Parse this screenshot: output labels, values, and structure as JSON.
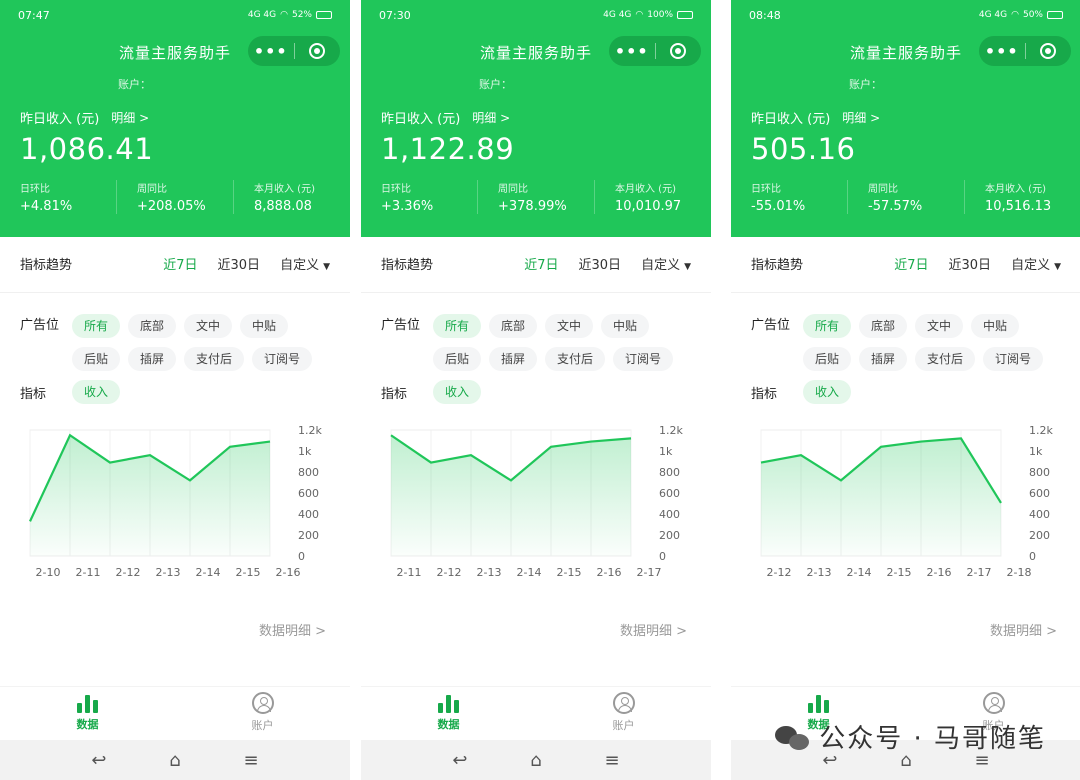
{
  "brand_watermark": "公众号 · 马哥随笔",
  "colors": {
    "primary": "#20c65a",
    "active_text": "#17a94a"
  },
  "screens": [
    {
      "status": {
        "time": "07:47",
        "signal": "4G 4G",
        "battery": "52%"
      },
      "title": "流量主服务助手",
      "account_label": "账户：",
      "income_label": "昨日收入 (元)",
      "detail_label": "明细 >",
      "income": "1,086.41",
      "stats": [
        {
          "label": "日环比",
          "value": "+4.81%"
        },
        {
          "label": "周同比",
          "value": "+208.05%"
        },
        {
          "label": "本月收入 (元)",
          "value": "8,888.08"
        }
      ],
      "trend_label": "指标趋势",
      "tabs": [
        "近7日",
        "近30日",
        "自定义"
      ],
      "ad_label": "广告位",
      "chips": [
        "所有",
        "底部",
        "文中",
        "中贴",
        "后贴",
        "插屏",
        "支付后",
        "订阅号"
      ],
      "metric_label": "指标",
      "metric_chip": "收入",
      "data_detail": "数据明细 >",
      "nav": [
        "数据",
        "账户"
      ],
      "chart_data": {
        "type": "area",
        "x": [
          "2-10",
          "2-11",
          "2-12",
          "2-13",
          "2-14",
          "2-15",
          "2-16"
        ],
        "values": [
          330,
          1150,
          890,
          960,
          720,
          1040,
          1090
        ],
        "yticks": [
          "0",
          "200",
          "400",
          "600",
          "800",
          "1k",
          "1.2k"
        ],
        "ylim": [
          0,
          1200
        ]
      }
    },
    {
      "status": {
        "time": "07:30",
        "signal": "4G 4G",
        "battery": "100%"
      },
      "title": "流量主服务助手",
      "account_label": "账户：",
      "income_label": "昨日收入 (元)",
      "detail_label": "明细 >",
      "income": "1,122.89",
      "stats": [
        {
          "label": "日环比",
          "value": "+3.36%"
        },
        {
          "label": "周同比",
          "value": "+378.99%"
        },
        {
          "label": "本月收入 (元)",
          "value": "10,010.97"
        }
      ],
      "trend_label": "指标趋势",
      "tabs": [
        "近7日",
        "近30日",
        "自定义"
      ],
      "ad_label": "广告位",
      "chips": [
        "所有",
        "底部",
        "文中",
        "中贴",
        "后贴",
        "插屏",
        "支付后",
        "订阅号"
      ],
      "metric_label": "指标",
      "metric_chip": "收入",
      "data_detail": "数据明细 >",
      "nav": [
        "数据",
        "账户"
      ],
      "chart_data": {
        "type": "area",
        "x": [
          "2-11",
          "2-12",
          "2-13",
          "2-14",
          "2-15",
          "2-16",
          "2-17"
        ],
        "values": [
          1150,
          890,
          960,
          720,
          1040,
          1090,
          1120
        ],
        "yticks": [
          "0",
          "200",
          "400",
          "600",
          "800",
          "1k",
          "1.2k"
        ],
        "ylim": [
          0,
          1200
        ]
      }
    },
    {
      "status": {
        "time": "08:48",
        "signal": "4G 4G",
        "battery": "50%"
      },
      "title": "流量主服务助手",
      "account_label": "账户：",
      "income_label": "昨日收入 (元)",
      "detail_label": "明细 >",
      "income": "505.16",
      "stats": [
        {
          "label": "日环比",
          "value": "-55.01%"
        },
        {
          "label": "周同比",
          "value": "-57.57%"
        },
        {
          "label": "本月收入 (元)",
          "value": "10,516.13"
        }
      ],
      "trend_label": "指标趋势",
      "tabs": [
        "近7日",
        "近30日",
        "自定义"
      ],
      "ad_label": "广告位",
      "chips": [
        "所有",
        "底部",
        "文中",
        "中贴",
        "后贴",
        "插屏",
        "支付后",
        "订阅号"
      ],
      "metric_label": "指标",
      "metric_chip": "收入",
      "data_detail": "数据明细 >",
      "nav": [
        "数据",
        "账户"
      ],
      "chart_data": {
        "type": "area",
        "x": [
          "2-12",
          "2-13",
          "2-14",
          "2-15",
          "2-16",
          "2-17",
          "2-18"
        ],
        "values": [
          890,
          960,
          720,
          1040,
          1090,
          1120,
          505
        ],
        "yticks": [
          "0",
          "200",
          "400",
          "600",
          "800",
          "1k",
          "1.2k"
        ],
        "ylim": [
          0,
          1200
        ]
      }
    }
  ]
}
